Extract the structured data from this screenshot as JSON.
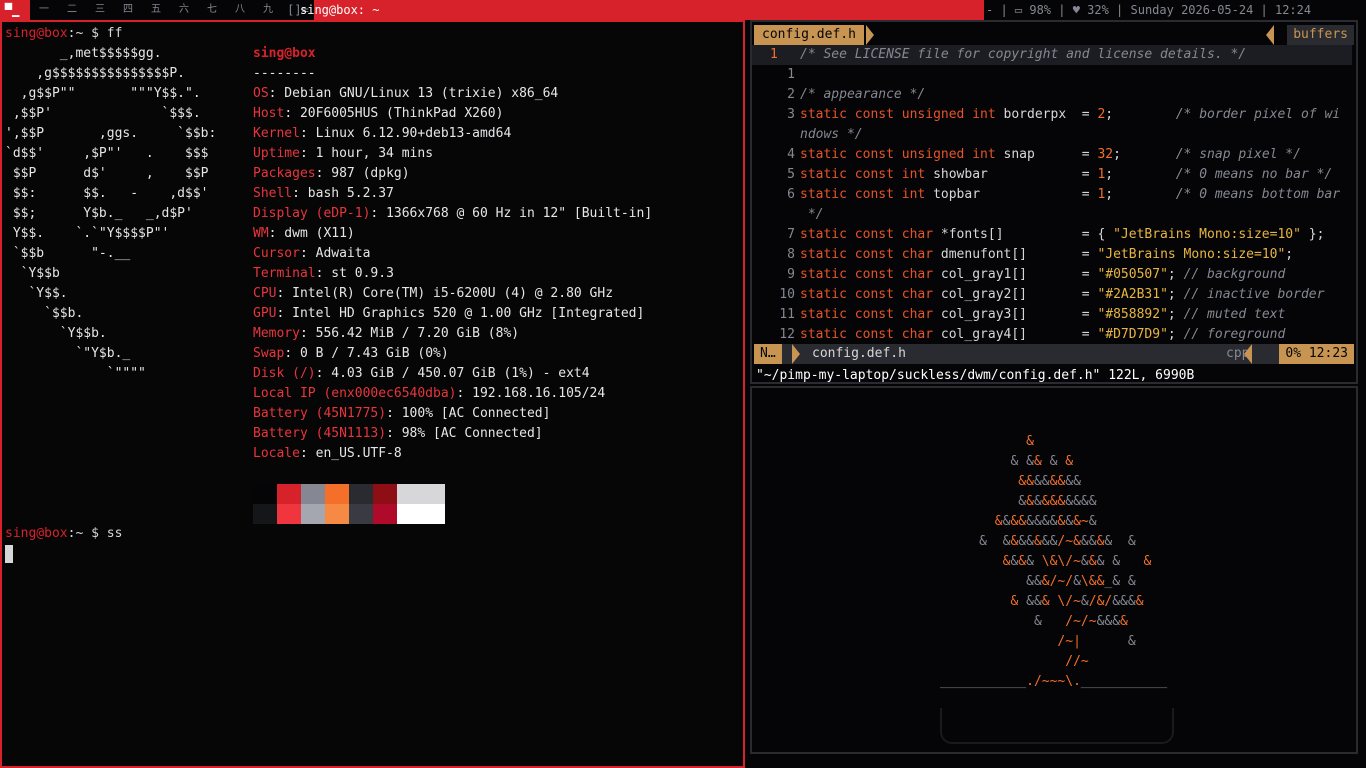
{
  "bar": {
    "layout_symbol": "▀▁",
    "tags": [
      "一",
      "二",
      "三",
      "四",
      "五",
      "六",
      "七",
      "八",
      "九"
    ],
    "layout": "[]=",
    "window_title": "sing@box: ~",
    "status": "- | ▭ 98% | ♥ 32% | Sunday 2026-05-24 | 12:24"
  },
  "terminal": {
    "prompt1": "sing@box",
    "prompt_tail": ":~ $ ",
    "cmd1": "ff",
    "logo": [
      "       _,met$$$$$gg.",
      "    ,g$$$$$$$$$$$$$$$P.",
      "  ,g$$P\"\"       \"\"\"Y$$.\".",
      " ,$$P'              `$$$.",
      "',$$P       ,ggs.     `$$b:",
      "`d$$'     ,$P\"'   .    $$$",
      " $$P      d$'     ,    $$P",
      " $$:      $$.   -    ,d$$'",
      " $$;      Y$b._   _,d$P'",
      " Y$$.    `.`\"Y$$$$P\"'",
      " `$$b      \"-.__",
      "  `Y$$b",
      "   `Y$$.",
      "     `$$b.",
      "       `Y$$b.",
      "         `\"Y$b._",
      "             `\"\"\"\""
    ],
    "user_host": "sing@box",
    "separator": "--------",
    "info": [
      {
        "k": "OS",
        "v": ": Debian GNU/Linux 13 (trixie) x86_64"
      },
      {
        "k": "Host",
        "v": ": 20F6005HUS (ThinkPad X260)"
      },
      {
        "k": "Kernel",
        "v": ": Linux 6.12.90+deb13-amd64"
      },
      {
        "k": "Uptime",
        "v": ": 1 hour, 34 mins"
      },
      {
        "k": "Packages",
        "v": ": 987 (dpkg)"
      },
      {
        "k": "Shell",
        "v": ": bash 5.2.37"
      },
      {
        "k": "Display (eDP-1)",
        "v": ": 1366x768 @ 60 Hz in 12\" [Built-in]"
      },
      {
        "k": "WM",
        "v": ": dwm (X11)"
      },
      {
        "k": "Cursor",
        "v": ": Adwaita"
      },
      {
        "k": "Terminal",
        "v": ": st 0.9.3"
      },
      {
        "k": "CPU",
        "v": ": Intel(R) Core(TM) i5-6200U (4) @ 2.80 GHz"
      },
      {
        "k": "GPU",
        "v": ": Intel HD Graphics 520 @ 1.00 GHz [Integrated]"
      },
      {
        "k": "Memory",
        "v": ": 556.42 MiB / 7.20 GiB (8%)"
      },
      {
        "k": "Swap",
        "v": ": 0 B / 7.43 GiB (0%)"
      },
      {
        "k": "Disk (/)",
        "v": ": 4.03 GiB / 450.07 GiB (1%) - ext4"
      },
      {
        "k": "Local IP (enx000ec6540dba)",
        "v": ": 192.168.16.105/24"
      },
      {
        "k": "Battery (45N1775)",
        "v": ": 100% [AC Connected]"
      },
      {
        "k": "Battery (45N1113)",
        "v": ": 98% [AC Connected]"
      },
      {
        "k": "Locale",
        "v": ": en_US.UTF-8"
      }
    ],
    "palette_top": [
      "#050507",
      "#D8222B",
      "#858892",
      "#F36F2A",
      "#2A2B31",
      "#8E0E15",
      "#D7D7D9",
      "#D7D7D9"
    ],
    "palette_bottom": [
      "#15161A",
      "#F0353F",
      "#A4A7AF",
      "#F68A45",
      "#3A3B42",
      "#B00A2A",
      "#FFFFFF",
      "#FFFFFF"
    ],
    "prompt2": "sing@box",
    "cmd2": "ss"
  },
  "vim": {
    "tab": "config.def.h",
    "buffers": "buffers",
    "lines": [
      {
        "n": "1",
        "t": "/* See LICENSE file for copyright and license details. */"
      },
      {
        "n": "1",
        "t": ""
      },
      {
        "n": "2",
        "t": "/* appearance */"
      },
      {
        "n": "3",
        "a": "static const unsigned int borderpx  = ",
        "b": "2",
        "c": ";        /* border pixel of wi"
      },
      {
        "n": "",
        "t": "ndows */"
      },
      {
        "n": "4",
        "a": "static const unsigned int snap      = ",
        "b": "32",
        "c": ";       /* snap pixel */"
      },
      {
        "n": "5",
        "a": "static const int showbar            = ",
        "b": "1",
        "c": ";        /* 0 means no bar */"
      },
      {
        "n": "6",
        "a": "static const int topbar             = ",
        "b": "1",
        "c": ";        /* 0 means bottom bar"
      },
      {
        "n": "",
        "t": " */"
      },
      {
        "n": "7",
        "a": "static const char *fonts[]          = { ",
        "s": "\"JetBrains Mono:size=10\"",
        "c": " };"
      },
      {
        "n": "8",
        "a": "static const char dmenufont[]       = ",
        "s": "\"JetBrains Mono:size=10\"",
        "c": ";"
      },
      {
        "n": "9",
        "a": "static const char col_gray1[]       = ",
        "s": "\"#050507\"",
        "c": "; // background"
      },
      {
        "n": "10",
        "a": "static const char col_gray2[]       = ",
        "s": "\"#2A2B31\"",
        "c": "; // inactive border"
      },
      {
        "n": "11",
        "a": "static const char col_gray3[]       = ",
        "s": "\"#858892\"",
        "c": "; // muted text"
      },
      {
        "n": "12",
        "a": "static const char col_gray4[]       = ",
        "s": "\"#D7D7D9\"",
        "c": "; // foreground"
      }
    ],
    "mode": "N…",
    "file": "config.def.h",
    "filetype": "cpp",
    "position": "0% 12:23",
    "cmdline": "\"~/pimp-my-laptop/suckless/dwm/config.def.h\" 122L, 6990B"
  },
  "bonsai": {
    "rows": [
      "           &",
      "         & && & &",
      "          &&&&&&&&",
      "          &&&&&&&&&&",
      "       &&&&&&&&&&&~&",
      "     &  &&&&&&&/~&&&&&  &",
      "        &&&& \\&\\/~&&& &   &",
      "           &&&/~/&\\&&_& &",
      "         & &&& \\/~&/&/&&&&",
      "            &   /~/~&&&&",
      "               /~|      &",
      "                //~",
      "___________./~~~\\.___________"
    ]
  }
}
